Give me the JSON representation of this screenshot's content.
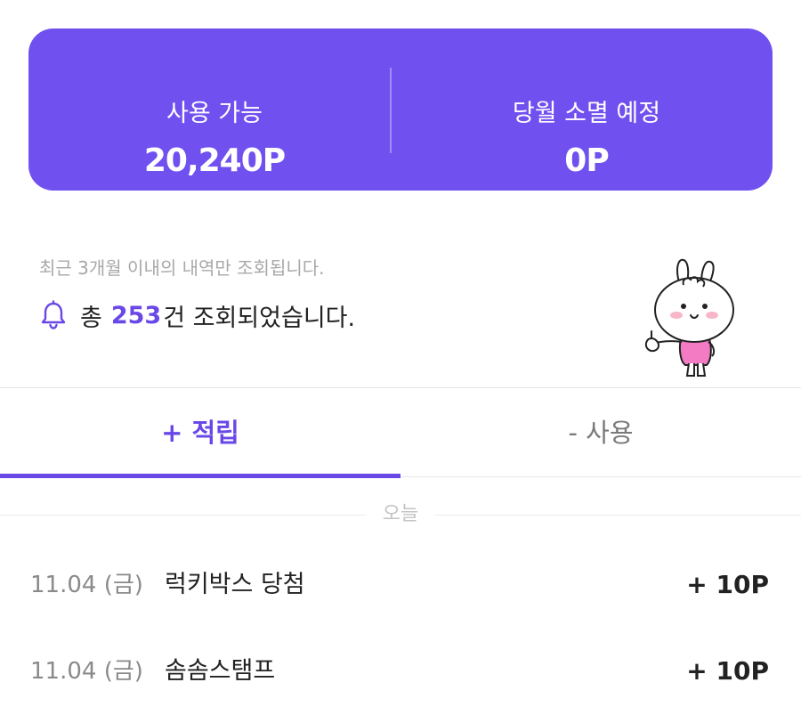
{
  "summary": {
    "available_label": "사용 가능",
    "available_value": "20,240P",
    "expiring_label": "당월 소멸 예정",
    "expiring_value": "0P"
  },
  "notice": "최근 3개월 이내의 내역만 조회됩니다.",
  "total": {
    "prefix": "총",
    "count": "253",
    "suffix": "건 조회되었습니다."
  },
  "tabs": {
    "earn": "+ 적립",
    "use": "- 사용"
  },
  "day_label": "오늘",
  "history": [
    {
      "date": "11.04 (금)",
      "title": "럭키박스 당첨",
      "points": "+ 10P"
    },
    {
      "date": "11.04 (금)",
      "title": "솜솜스탬프",
      "points": "+ 10P"
    }
  ],
  "icons": [
    "bell-icon",
    "mascot-rabbit"
  ],
  "colors": {
    "accent": "#7150f0",
    "accent_text": "#6a48e8"
  }
}
